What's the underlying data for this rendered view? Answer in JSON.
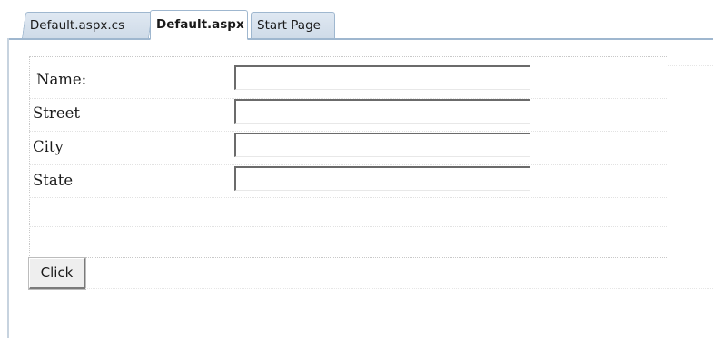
{
  "tabs": [
    {
      "label": "Default.aspx.cs",
      "active": false
    },
    {
      "label": "Default.aspx",
      "active": true
    },
    {
      "label": "Start Page",
      "active": false
    }
  ],
  "form": {
    "name_label": "Name:",
    "street_label": "Street",
    "city_label": "City",
    "state_label": "State",
    "name_value": "",
    "street_value": "",
    "city_value": "",
    "state_value": ""
  },
  "button": {
    "label": "Click"
  },
  "colors": {
    "tab_border": "#9fb7cf",
    "tab_inactive_bg": "#dfe8f2",
    "textbox_border": "#6b6b6b",
    "button_bg": "#eeeeee"
  }
}
